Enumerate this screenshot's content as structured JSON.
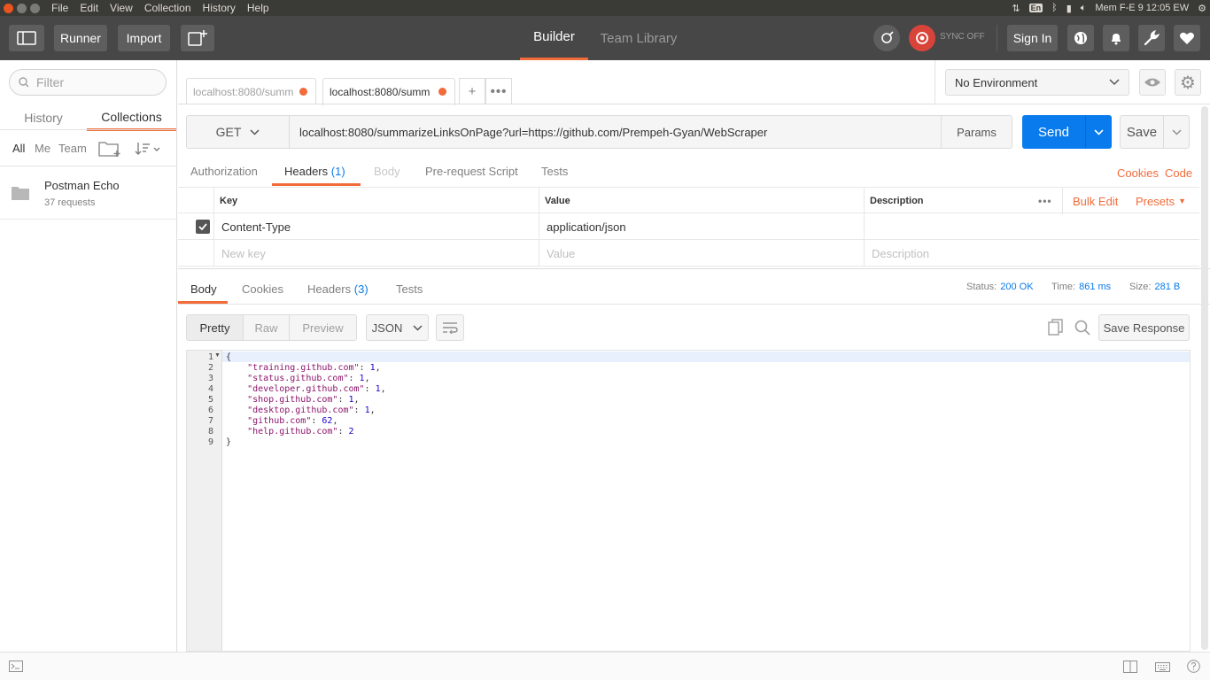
{
  "os_menu": {
    "items": [
      "File",
      "Edit",
      "View",
      "Collection",
      "History",
      "Help"
    ],
    "kbd_layout": "En",
    "clock": "Mem F-E  9 12:05 EW"
  },
  "header": {
    "runner_label": "Runner",
    "import_label": "Import",
    "builder_label": "Builder",
    "team_library_label": "Team Library",
    "sync_label": "SYNC OFF",
    "sign_in_label": "Sign In"
  },
  "sidebar": {
    "filter_placeholder": "Filter",
    "tabs": [
      "History",
      "Collections"
    ],
    "filters": [
      "All",
      "Me",
      "Team"
    ],
    "collection": {
      "name": "Postman Echo",
      "count": "37 requests"
    }
  },
  "request_tabs": [
    {
      "label": "localhost:8080/summ",
      "active": false
    },
    {
      "label": "localhost:8080/summ",
      "active": true
    }
  ],
  "environment": {
    "selected": "No Environment"
  },
  "request": {
    "method": "GET",
    "url": "localhost:8080/summarizeLinksOnPage?url=https://github.com/Prempeh-Gyan/WebScraper",
    "params_label": "Params",
    "send_label": "Send",
    "save_label": "Save"
  },
  "sub_tabs": {
    "authorization": "Authorization",
    "headers": "Headers",
    "headers_count": "(1)",
    "body": "Body",
    "prerequest": "Pre-request Script",
    "tests": "Tests",
    "cookies": "Cookies",
    "code": "Code"
  },
  "headers_table": {
    "col_key": "Key",
    "col_value": "Value",
    "col_description": "Description",
    "bulk_edit": "Bulk Edit",
    "presets": "Presets",
    "row": {
      "key": "Content-Type",
      "value": "application/json"
    },
    "new_key_placeholder": "New key",
    "new_value_placeholder": "Value",
    "new_description_placeholder": "Description"
  },
  "response": {
    "tabs": {
      "body": "Body",
      "cookies": "Cookies",
      "headers": "Headers",
      "headers_count": "(3)",
      "tests": "Tests"
    },
    "status_label": "Status:",
    "status_value": "200 OK",
    "time_label": "Time:",
    "time_value": "861 ms",
    "size_label": "Size:",
    "size_value": "281 B",
    "views": [
      "Pretty",
      "Raw",
      "Preview"
    ],
    "format": "JSON",
    "save_response_label": "Save Response",
    "code_lines": [
      {
        "ln": "1",
        "key": "",
        "val": "",
        "raw": "{"
      },
      {
        "ln": "2",
        "key": "\"training.github.com\"",
        "val": "1",
        "sep": ","
      },
      {
        "ln": "3",
        "key": "\"status.github.com\"",
        "val": "1",
        "sep": ","
      },
      {
        "ln": "4",
        "key": "\"developer.github.com\"",
        "val": "1",
        "sep": ","
      },
      {
        "ln": "5",
        "key": "\"shop.github.com\"",
        "val": "1",
        "sep": ","
      },
      {
        "ln": "6",
        "key": "\"desktop.github.com\"",
        "val": "1",
        "sep": ","
      },
      {
        "ln": "7",
        "key": "\"github.com\"",
        "val": "62",
        "sep": ","
      },
      {
        "ln": "8",
        "key": "\"help.github.com\"",
        "val": "2",
        "sep": ""
      },
      {
        "ln": "9",
        "key": "",
        "val": "",
        "raw": "}"
      }
    ]
  },
  "colors": {
    "accent": "#f26b3a",
    "primary": "#097bed",
    "header_bg": "#474747"
  }
}
